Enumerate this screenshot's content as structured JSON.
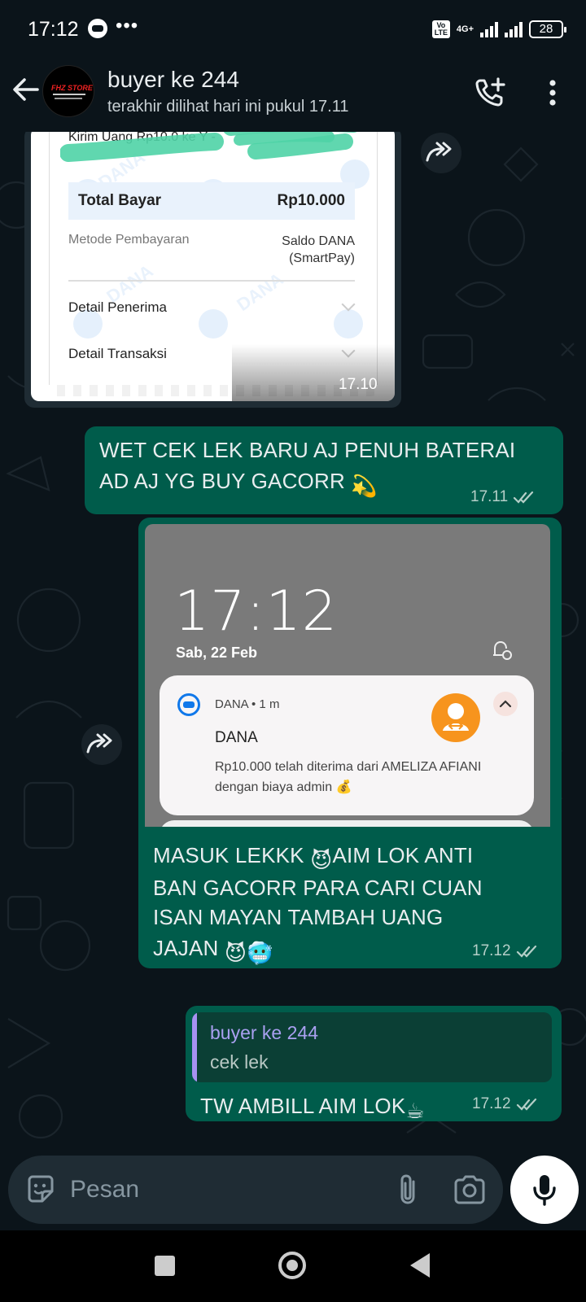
{
  "status_bar": {
    "time": "17:12",
    "more": "•••",
    "volte": "Vo LTE",
    "network": "4G+",
    "battery": "28"
  },
  "header": {
    "contact_name": "buyer ke 244",
    "last_seen": "terakhir dilihat hari ini pukul 17.11",
    "avatar_logo_text": "FHZ STORE"
  },
  "messages": [
    {
      "type": "image_receipt",
      "direction": "incoming",
      "receipt": {
        "kirim_line": "Kirim Uang Rp10.0   ke Y                     -",
        "total_label": "Total Bayar",
        "total_value": "Rp10.000",
        "method_label": "Metode Pembayaran",
        "method_value": "Saldo DANA (SmartPay)",
        "detail_penerima": "Detail Penerima",
        "detail_transaksi": "Detail Transaksi",
        "watermark": "DANA"
      },
      "time": "17.10"
    },
    {
      "type": "text",
      "direction": "outgoing",
      "text_line_1": "WET CEK LEK BARU AJ PENUH BATERAI",
      "text_line_2": "AD AJ YG BUY GACORR",
      "emoji": "💫",
      "time": "17.11",
      "status": "read"
    },
    {
      "type": "image_notification",
      "direction": "outgoing",
      "lockscreen": {
        "time": "17:12",
        "date": "Sab, 22 Feb"
      },
      "notification": {
        "app": "DANA • 1 m",
        "title": "DANA",
        "body_line_1": "Rp10.000 telah diterima dari AMELIZA AFIANI",
        "body_line_2": "dengan biaya admin",
        "body_emoji": "💰"
      },
      "caption_line_1": "MASUK LEKKK",
      "caption_emoji_1": "😈",
      "caption_line_1b": "AIM LOK ANTI",
      "caption_line_2": "BAN GACORR PARA CARI CUAN",
      "caption_line_3": "ISAN MAYAN TAMBAH UANG",
      "caption_line_4": "JAJAN",
      "caption_emoji_2": "😈🥶",
      "time": "17.12",
      "status": "read"
    },
    {
      "type": "reply",
      "direction": "outgoing",
      "quoted_name": "buyer ke 244",
      "quoted_text": "cek lek",
      "text": "TW AMBILL AIM LOK",
      "emoji": "☕",
      "time": "17.12",
      "status": "read"
    }
  ],
  "input": {
    "placeholder": "Pesan"
  },
  "colors": {
    "background": "#0b141a",
    "outgoing_bubble": "#005c4b",
    "incoming_bubble": "#1f2c34",
    "quote_accent": "#a791f2"
  },
  "icons": [
    "back-arrow-icon",
    "call-add-icon",
    "more-vert-icon",
    "forward-icon",
    "emoji-sticker-icon",
    "paperclip-icon",
    "camera-icon",
    "mic-icon",
    "double-check-icon"
  ]
}
